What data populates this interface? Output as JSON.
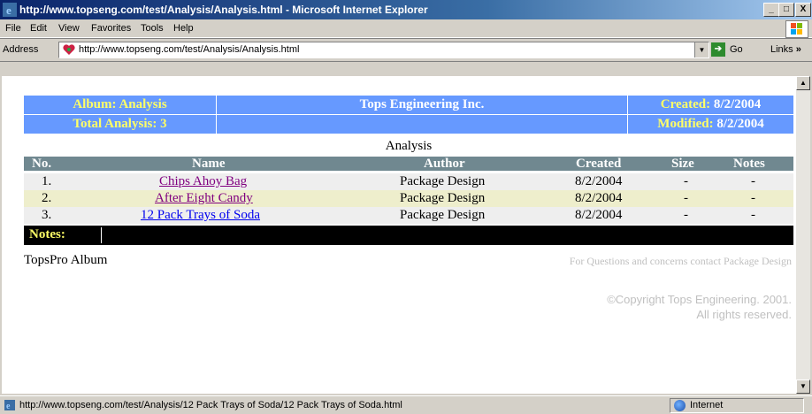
{
  "window": {
    "title": "http://www.topseng.com/test/Analysis/Analysis.html - Microsoft Internet Explorer",
    "minimize": "_",
    "maximize": "□",
    "close": "X"
  },
  "menu": [
    "File",
    "Edit",
    "View",
    "Favorites",
    "Tools",
    "Help"
  ],
  "address": {
    "label": "Address",
    "url": "http://www.topseng.com/test/Analysis/Analysis.html",
    "go_label": "Go",
    "links_label": "Links",
    "links_more": "»"
  },
  "page": {
    "header": {
      "album_label": "Album:",
      "album_value": "Analysis",
      "company": "Tops Engineering Inc.",
      "created_label": "Created:",
      "created_value": "8/2/2004",
      "total_label": "Total Analysis:",
      "total_value": "3",
      "modified_label": "Modified:",
      "modified_value": "8/2/2004"
    },
    "caption": "Analysis",
    "columns": [
      "No.",
      "Name",
      "Author",
      "Created",
      "Size",
      "Notes"
    ],
    "rows": [
      {
        "no": "1.",
        "name": "Chips Ahoy Bag",
        "author": "Package Design",
        "created": "8/2/2004",
        "size": "-",
        "notes": "-"
      },
      {
        "no": "2.",
        "name": "After Eight Candy",
        "author": "Package Design",
        "created": "8/2/2004",
        "size": "-",
        "notes": "-"
      },
      {
        "no": "3.",
        "name": "12 Pack Trays of Soda",
        "author": "Package Design",
        "created": "8/2/2004",
        "size": "-",
        "notes": "-"
      }
    ],
    "notes_label": "Notes:",
    "footer_left": "TopsPro Album",
    "footer_right": "For Questions and concerns contact Package Design",
    "copyright_line1": "©Copyright Tops Engineering. 2001.",
    "copyright_line2": "All rights reserved."
  },
  "status": {
    "text": "http://www.topseng.com/test/Analysis/12 Pack Trays of Soda/12 Pack Trays of Soda.html",
    "zone": "Internet"
  },
  "colors": {
    "header_bg": "#6699ff",
    "header_text": "#ffff66",
    "table_header_bg": "#708890",
    "row_alt_bg": "#eeeecc",
    "row_bg": "#eeeeee",
    "visited_link": "#800080",
    "link": "#0000ee"
  },
  "icons": [
    "ie-icon",
    "windows-logo-icon",
    "favicon-icon",
    "go-arrow-icon",
    "page-icon",
    "globe-icon"
  ]
}
